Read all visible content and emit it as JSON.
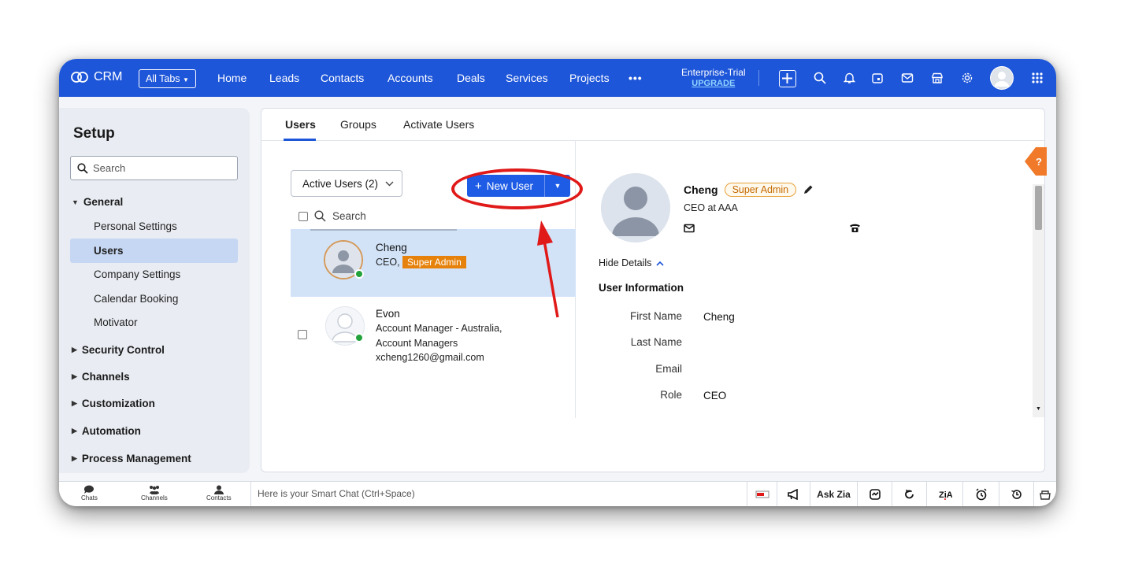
{
  "topbar": {
    "app_name": "CRM",
    "all_tabs": "All Tabs",
    "nav": [
      "Home",
      "Leads",
      "Contacts",
      "Accounts",
      "Deals",
      "Services",
      "Projects"
    ],
    "more": "•••",
    "trial_label": "Enterprise-Trial",
    "upgrade": "UPGRADE",
    "icons": [
      "plus-icon",
      "search-icon",
      "bell-icon",
      "calendar-icon",
      "mail-icon",
      "store-icon",
      "gear-icon",
      "avatar",
      "apps-grid-icon"
    ]
  },
  "sidebar": {
    "title": "Setup",
    "search_placeholder": "Search",
    "general": "General",
    "general_items": [
      "Personal Settings",
      "Users",
      "Company Settings",
      "Calendar Booking",
      "Motivator"
    ],
    "selected_item": "Users",
    "groups": [
      "Security Control",
      "Channels",
      "Customization",
      "Automation",
      "Process Management"
    ]
  },
  "tabs": [
    "Users",
    "Groups",
    "Activate Users"
  ],
  "users_panel": {
    "filter": "Active Users (2)",
    "new_user": "New User",
    "search_placeholder": "Search",
    "users": [
      {
        "name": "Cheng",
        "title": "CEO,",
        "badge": "Super Admin"
      },
      {
        "name": "Evon",
        "title_line1": "Account Manager - Australia,",
        "title_line2": "Account Managers",
        "email": "xcheng1260@gmail.com"
      }
    ]
  },
  "details": {
    "name": "Cheng",
    "badge": "Super Admin",
    "subtitle": "CEO at AAA",
    "hide_details": "Hide Details",
    "section": "User Information",
    "fields": [
      {
        "label": "First Name",
        "value": "Cheng"
      },
      {
        "label": "Last Name",
        "value": ""
      },
      {
        "label": "Email",
        "value": ""
      },
      {
        "label": "Role",
        "value": "CEO"
      }
    ],
    "help": "?"
  },
  "bottombar": {
    "chats": "Chats",
    "channels": "Channels",
    "contacts": "Contacts",
    "smartchat": "Here is your Smart Chat (Ctrl+Space)",
    "ask_zia": "Ask Zia"
  },
  "colors": {
    "brand": "#1e56d9",
    "accent_orange": "#e6820b",
    "annotation_red": "#e01919"
  }
}
